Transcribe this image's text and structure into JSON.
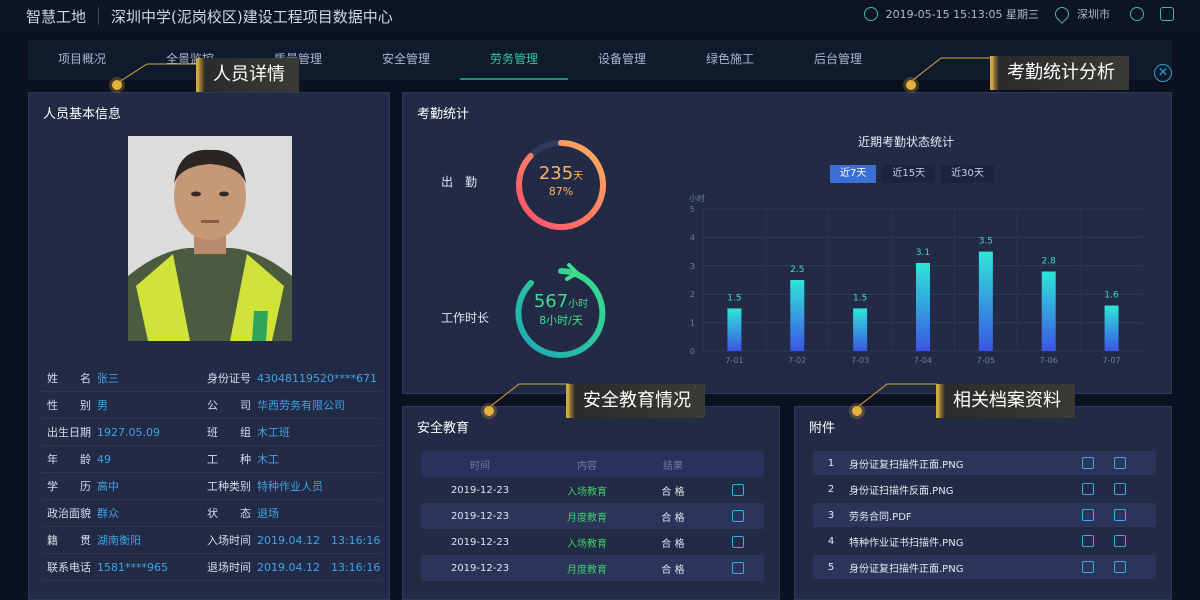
{
  "header": {
    "brand": "智慧工地",
    "project_title": "深圳中学(泥岗校区)建设工程项目数据中心",
    "datetime": "2019-05-15 15:13:05 星期三",
    "city": "深圳市"
  },
  "nav": {
    "tabs": [
      "项目概况",
      "全景监控",
      "质量管理",
      "安全管理",
      "劳务管理",
      "设备管理",
      "绿色施工",
      "后台管理"
    ],
    "active_index": 4
  },
  "callouts": {
    "person": "人员详情",
    "attendance": "考勤统计分析",
    "safety": "安全教育情况",
    "archive": "相关档案资料"
  },
  "person": {
    "title": "人员基本信息",
    "rows": [
      {
        "l1": "姓　　名",
        "v1": "张三",
        "l2": "身份证号",
        "v2": "43048119520****671"
      },
      {
        "l1": "性　　别",
        "v1": "男",
        "l2": "公　　司",
        "v2": "华西劳务有限公司"
      },
      {
        "l1": "出生日期",
        "v1": "1927.05.09",
        "l2": "班　　组",
        "v2": "木工班"
      },
      {
        "l1": "年　　龄",
        "v1": "49",
        "l2": "工　　种",
        "v2": "木工"
      },
      {
        "l1": "学　　历",
        "v1": "高中",
        "l2": "工种类别",
        "v2": "特种作业人员"
      },
      {
        "l1": "政治面貌",
        "v1": "群众",
        "l2": "状　　态",
        "v2": "退场"
      },
      {
        "l1": "籍　　贯",
        "v1": "湖南衡阳",
        "l2": "入场时间",
        "v2": "2019.04.12　13:16:16"
      },
      {
        "l1": "联系电话",
        "v1": "1581****965",
        "l2": "退场时间",
        "v2": "2019.04.12　13:16:16"
      }
    ]
  },
  "attendance": {
    "title": "考勤统计",
    "attend_label": "出　勤",
    "attend_days": "235",
    "attend_unit": "天",
    "attend_percent": "87%",
    "attend_ratio": 0.87,
    "work_label": "工作时长",
    "work_hours": "567",
    "work_unit": "小时",
    "work_per_day": "8小时/天",
    "chart_title": "近期考勤状态统计",
    "ranges": [
      "近7天",
      "近15天",
      "近30天"
    ],
    "active_range": 0
  },
  "chart_data": {
    "type": "bar",
    "ylabel": "小时",
    "categories": [
      "7-01",
      "7-02",
      "7-03",
      "7-04",
      "7-05",
      "7-06",
      "7-07"
    ],
    "values": [
      1.5,
      2.5,
      1.5,
      3.1,
      3.5,
      2.8,
      1.6
    ],
    "ylim": [
      0,
      5
    ],
    "yticks": [
      "0",
      "1",
      "2",
      "3",
      "4",
      "5"
    ]
  },
  "safety": {
    "title": "安全教育",
    "columns": [
      "时间",
      "内容",
      "结果"
    ],
    "rows": [
      {
        "date": "2019-12-23",
        "content": "入场教育",
        "result": "合 格"
      },
      {
        "date": "2019-12-23",
        "content": "月度教育",
        "result": "合 格"
      },
      {
        "date": "2019-12-23",
        "content": "入场教育",
        "result": "合 格"
      },
      {
        "date": "2019-12-23",
        "content": "月度教育",
        "result": "合 格"
      }
    ]
  },
  "attachments": {
    "title": "附件",
    "items": [
      {
        "no": "1",
        "name": "身份证复扫描件正面.PNG"
      },
      {
        "no": "2",
        "name": "身份证扫描件反面.PNG"
      },
      {
        "no": "3",
        "name": "劳务合同.PDF"
      },
      {
        "no": "4",
        "name": "特种作业证书扫描件.PNG"
      },
      {
        "no": "5",
        "name": "身份证复扫描件正面.PNG"
      }
    ]
  },
  "colors": {
    "accent_green": "#34c7a4",
    "bar_top": "#2ee6d8",
    "bar_bottom": "#3b55e6",
    "gold": "#d4a93c"
  }
}
